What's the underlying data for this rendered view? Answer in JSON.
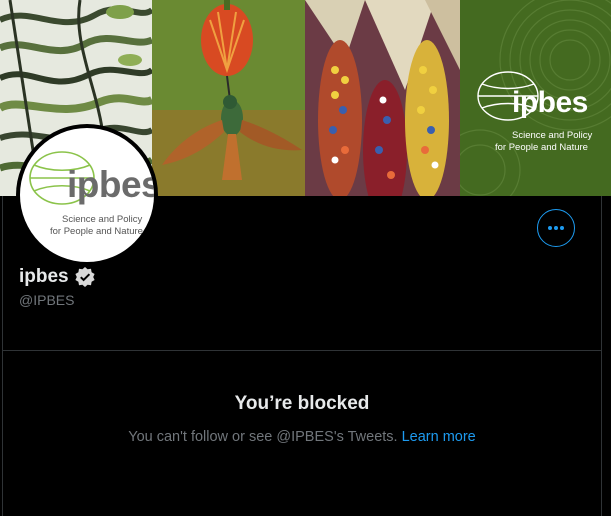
{
  "banner": {
    "brand_word": "ipbes",
    "tagline_line1": "Science and Policy",
    "tagline_line2": "for People and Nature"
  },
  "avatar": {
    "brand_word": "ipbes",
    "tagline_line1": "Science and Policy",
    "tagline_line2": "for People and Nature"
  },
  "profile": {
    "display_name": "ipbes",
    "handle": "@IPBES",
    "verified": true
  },
  "blocked": {
    "title": "You’re blocked",
    "message": "You can't follow or see @IPBES's Tweets.",
    "link_label": "Learn more"
  },
  "colors": {
    "background": "#000000",
    "accent": "#1d9bf0",
    "secondary_text": "#71767b",
    "divider": "#2f3336",
    "banner_green": "#43681f"
  },
  "icons": {
    "more": "more-horizontal-icon",
    "verified": "verified-badge-icon"
  }
}
